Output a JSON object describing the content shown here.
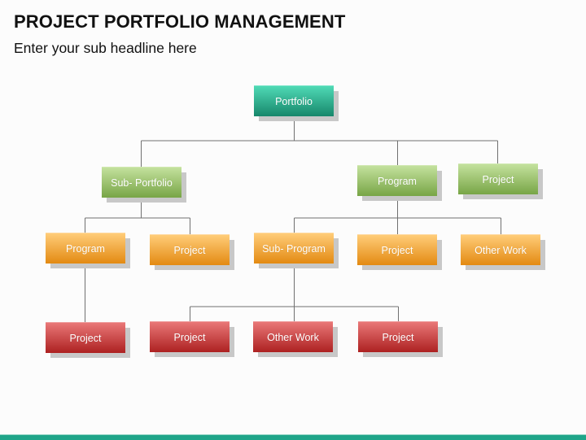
{
  "header": {
    "title": "PROJECT PORTFOLIO MANAGEMENT",
    "subtitle": "Enter your sub headline here"
  },
  "colors": {
    "portfolio": "#1fa589",
    "level2": "#8cb85a",
    "level3": "#f4a028",
    "level4": "#c83232",
    "footer": "#1fa589",
    "connector": "#707070"
  },
  "diagram": {
    "root": {
      "label": "Portfolio"
    },
    "level2": [
      {
        "label": "Sub- Portfolio"
      },
      {
        "label": "Program"
      },
      {
        "label": "Project"
      }
    ],
    "level3": [
      {
        "label": "Program",
        "parent": "Sub- Portfolio"
      },
      {
        "label": "Project",
        "parent": "Sub- Portfolio"
      },
      {
        "label": "Sub- Program",
        "parent": "Program"
      },
      {
        "label": "Project",
        "parent": "Program"
      },
      {
        "label": "Other Work",
        "parent": "Program"
      }
    ],
    "level4": [
      {
        "label": "Project",
        "parent": "Program"
      },
      {
        "label": "Project",
        "parent": "Sub- Program"
      },
      {
        "label": "Other Work",
        "parent": "Sub- Program"
      },
      {
        "label": "Project",
        "parent": "Sub- Program"
      }
    ]
  }
}
